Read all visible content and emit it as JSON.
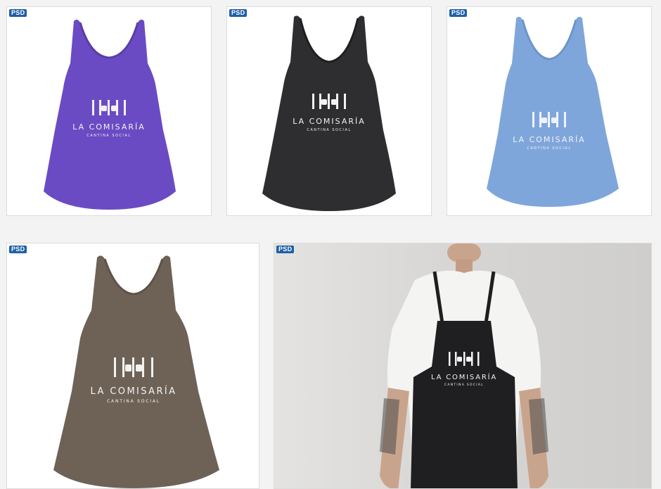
{
  "badge_label": "PSD",
  "logo": {
    "prefix": "LA",
    "name": "COMISARÍA",
    "tagline": "CANTINA SOCIAL"
  },
  "cards": [
    {
      "product": "tank-top",
      "color": "#6b4bc4"
    },
    {
      "product": "tank-top",
      "color": "#2e2e30"
    },
    {
      "product": "tank-top",
      "color": "#7fa6db"
    },
    {
      "product": "tank-top",
      "color": "#6e6256"
    },
    {
      "product": "apron",
      "color": "#1f1f21"
    }
  ]
}
